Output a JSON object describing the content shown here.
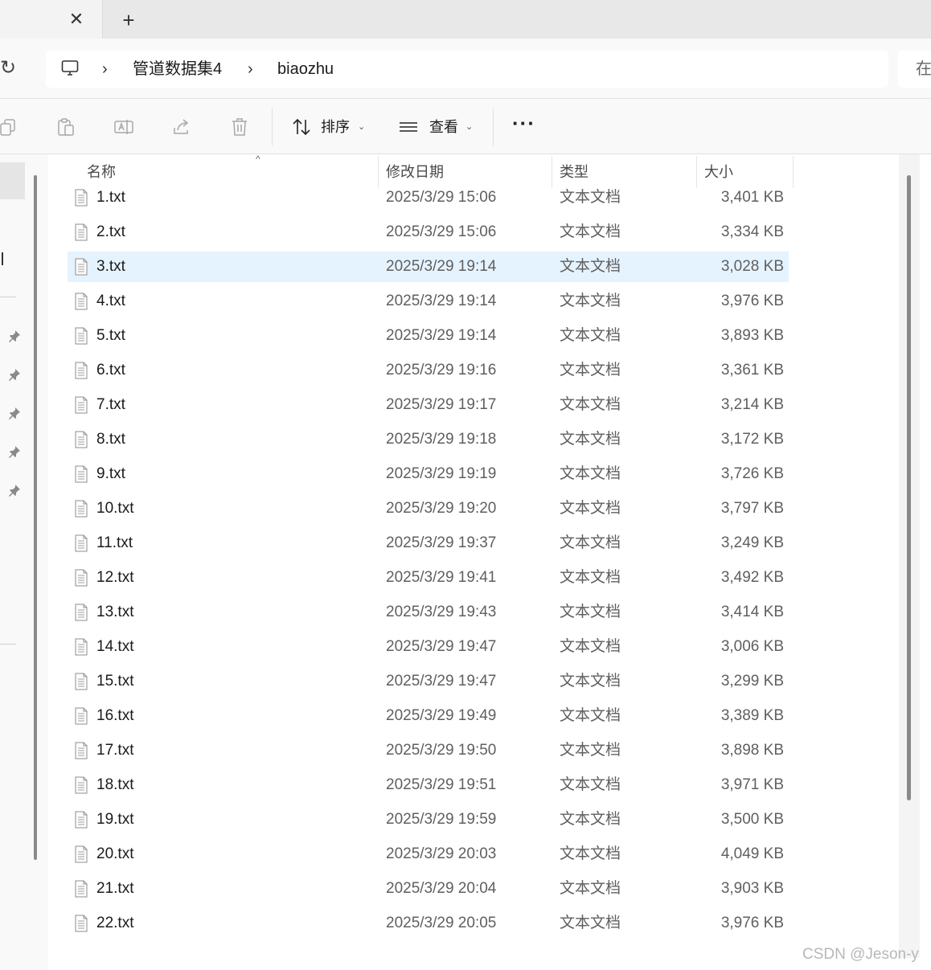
{
  "tabbar": {
    "close_glyph": "✕",
    "new_tab_glyph": "+"
  },
  "address": {
    "refresh_glyph": "↻",
    "sep1": "›",
    "crumb1": "管道数据集4",
    "sep2": "›",
    "crumb2": "biaozhu",
    "search_fragment": "在"
  },
  "toolbar": {
    "sort_label": "排序",
    "view_label": "查看",
    "chevron": "⌄",
    "more_glyph": "···"
  },
  "columns": {
    "name": "名称",
    "date": "修改日期",
    "type": "类型",
    "size": "大小",
    "sort_arrow": "^"
  },
  "files": [
    {
      "name": "1.txt",
      "date": "2025/3/29 15:06",
      "type": "文本文档",
      "size": "3,401 KB"
    },
    {
      "name": "2.txt",
      "date": "2025/3/29 15:06",
      "type": "文本文档",
      "size": "3,334 KB"
    },
    {
      "name": "3.txt",
      "date": "2025/3/29 19:14",
      "type": "文本文档",
      "size": "3,028 KB"
    },
    {
      "name": "4.txt",
      "date": "2025/3/29 19:14",
      "type": "文本文档",
      "size": "3,976 KB"
    },
    {
      "name": "5.txt",
      "date": "2025/3/29 19:14",
      "type": "文本文档",
      "size": "3,893 KB"
    },
    {
      "name": "6.txt",
      "date": "2025/3/29 19:16",
      "type": "文本文档",
      "size": "3,361 KB"
    },
    {
      "name": "7.txt",
      "date": "2025/3/29 19:17",
      "type": "文本文档",
      "size": "3,214 KB"
    },
    {
      "name": "8.txt",
      "date": "2025/3/29 19:18",
      "type": "文本文档",
      "size": "3,172 KB"
    },
    {
      "name": "9.txt",
      "date": "2025/3/29 19:19",
      "type": "文本文档",
      "size": "3,726 KB"
    },
    {
      "name": "10.txt",
      "date": "2025/3/29 19:20",
      "type": "文本文档",
      "size": "3,797 KB"
    },
    {
      "name": "11.txt",
      "date": "2025/3/29 19:37",
      "type": "文本文档",
      "size": "3,249 KB"
    },
    {
      "name": "12.txt",
      "date": "2025/3/29 19:41",
      "type": "文本文档",
      "size": "3,492 KB"
    },
    {
      "name": "13.txt",
      "date": "2025/3/29 19:43",
      "type": "文本文档",
      "size": "3,414 KB"
    },
    {
      "name": "14.txt",
      "date": "2025/3/29 19:47",
      "type": "文本文档",
      "size": "3,006 KB"
    },
    {
      "name": "15.txt",
      "date": "2025/3/29 19:47",
      "type": "文本文档",
      "size": "3,299 KB"
    },
    {
      "name": "16.txt",
      "date": "2025/3/29 19:49",
      "type": "文本文档",
      "size": "3,389 KB"
    },
    {
      "name": "17.txt",
      "date": "2025/3/29 19:50",
      "type": "文本文档",
      "size": "3,898 KB"
    },
    {
      "name": "18.txt",
      "date": "2025/3/29 19:51",
      "type": "文本文档",
      "size": "3,971 KB"
    },
    {
      "name": "19.txt",
      "date": "2025/3/29 19:59",
      "type": "文本文档",
      "size": "3,500 KB"
    },
    {
      "name": "20.txt",
      "date": "2025/3/29 20:03",
      "type": "文本文档",
      "size": "4,049 KB"
    },
    {
      "name": "21.txt",
      "date": "2025/3/29 20:04",
      "type": "文本文档",
      "size": "3,903 KB"
    },
    {
      "name": "22.txt",
      "date": "2025/3/29 20:05",
      "type": "文本文档",
      "size": "3,976 KB"
    }
  ],
  "selected_file": "3.txt",
  "watermark": "CSDN @Jeson-y",
  "colors": {
    "selection": "#e5f3ff",
    "toolbar_bg": "#f9f9f9",
    "tab_strip": "#e8e8e8",
    "disabled_icon": "#a8a8a8"
  }
}
